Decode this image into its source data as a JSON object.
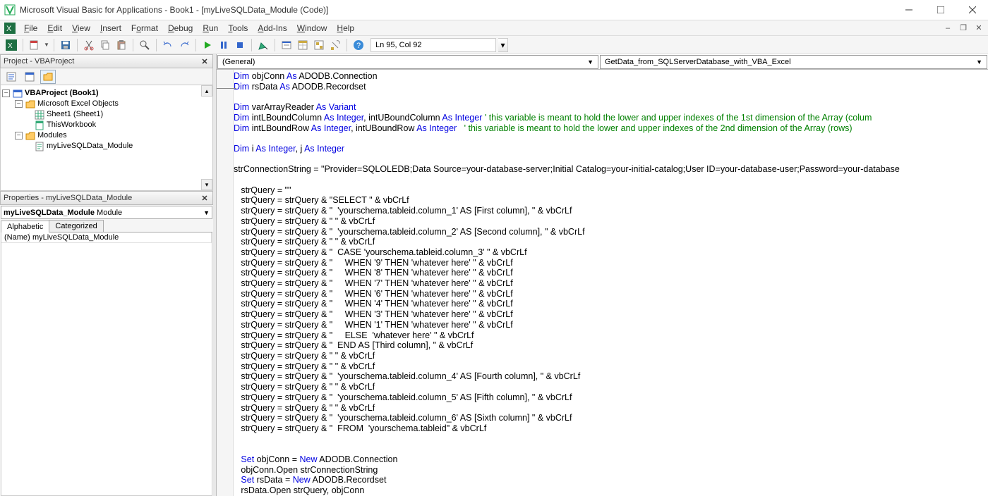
{
  "window": {
    "title": "Microsoft Visual Basic for Applications - Book1 - [myLiveSQLData_Module (Code)]"
  },
  "menus": {
    "file": "File",
    "edit": "Edit",
    "view": "View",
    "insert": "Insert",
    "format": "Format",
    "debug": "Debug",
    "run": "Run",
    "tools": "Tools",
    "addins": "Add-Ins",
    "window": "Window",
    "help": "Help"
  },
  "toolbar_status": "Ln 95, Col 92",
  "project_pane": {
    "title": "Project - VBAProject",
    "tree": {
      "root": "VBAProject (Book1)",
      "excel_objects": "Microsoft Excel Objects",
      "sheet1": "Sheet1 (Sheet1)",
      "thisworkbook": "ThisWorkbook",
      "modules": "Modules",
      "module1": "myLiveSQLData_Module"
    }
  },
  "properties_pane": {
    "title": "Properties - myLiveSQLData_Module",
    "combo_name": "myLiveSQLData_Module",
    "combo_type": "Module",
    "tab_alpha": "Alphabetic",
    "tab_cat": "Categorized",
    "row_name_key": "(Name)",
    "row_name_val": "myLiveSQLData_Module"
  },
  "code_combos": {
    "object": "(General)",
    "procedure": "GetData_from_SQLServerDatabase_with_VBA_Excel"
  },
  "code": {
    "tokens": [
      [
        [
          "kw",
          "Dim"
        ],
        [
          "",
          " objConn "
        ],
        [
          "kw",
          "As"
        ],
        [
          "",
          " ADODB.Connection"
        ]
      ],
      [
        [
          "kw",
          "Dim"
        ],
        [
          "",
          " rsData "
        ],
        [
          "kw",
          "As"
        ],
        [
          "",
          " ADODB.Recordset"
        ]
      ],
      [],
      [
        [
          "kw",
          "Dim"
        ],
        [
          "",
          " varArrayReader "
        ],
        [
          "kw",
          "As"
        ],
        [
          "",
          " "
        ],
        [
          "kw",
          "Variant"
        ]
      ],
      [
        [
          "kw",
          "Dim"
        ],
        [
          "",
          " intLBoundColumn "
        ],
        [
          "kw",
          "As"
        ],
        [
          "",
          " "
        ],
        [
          "kw",
          "Integer"
        ],
        [
          "",
          ", intUBoundColumn "
        ],
        [
          "kw",
          "As"
        ],
        [
          "",
          " "
        ],
        [
          "kw",
          "Integer"
        ],
        [
          "",
          " "
        ],
        [
          "cm",
          "' this variable is meant to hold the lower and upper indexes of the 1st dimension of the Array (colum"
        ]
      ],
      [
        [
          "kw",
          "Dim"
        ],
        [
          "",
          " intLBoundRow "
        ],
        [
          "kw",
          "As"
        ],
        [
          "",
          " "
        ],
        [
          "kw",
          "Integer"
        ],
        [
          "",
          ", intUBoundRow "
        ],
        [
          "kw",
          "As"
        ],
        [
          "",
          " "
        ],
        [
          "kw",
          "Integer"
        ],
        [
          "",
          "   "
        ],
        [
          "cm",
          "' this variable is meant to hold the lower and upper indexes of the 2nd dimension of the Array (rows)"
        ]
      ],
      [],
      [
        [
          "kw",
          "Dim"
        ],
        [
          "",
          " i "
        ],
        [
          "kw",
          "As"
        ],
        [
          "",
          " "
        ],
        [
          "kw",
          "Integer"
        ],
        [
          "",
          ", j "
        ],
        [
          "kw",
          "As"
        ],
        [
          "",
          " "
        ],
        [
          "kw",
          "Integer"
        ]
      ],
      [],
      [
        [
          "",
          "strConnectionString = \"Provider=SQLOLEDB;Data Source=your-database-server;Initial Catalog=your-initial-catalog;User ID=your-database-user;Password=your-database"
        ]
      ],
      [],
      [
        [
          "",
          "   strQuery = \"\""
        ]
      ],
      [
        [
          "",
          "   strQuery = strQuery & \"SELECT \" & vbCrLf"
        ]
      ],
      [
        [
          "",
          "   strQuery = strQuery & \"  'yourschema.tableid.column_1' AS [First column], \" & vbCrLf"
        ]
      ],
      [
        [
          "",
          "   strQuery = strQuery & \" \" & vbCrLf"
        ]
      ],
      [
        [
          "",
          "   strQuery = strQuery & \"  'yourschema.tableid.column_2' AS [Second column], \" & vbCrLf"
        ]
      ],
      [
        [
          "",
          "   strQuery = strQuery & \" \" & vbCrLf"
        ]
      ],
      [
        [
          "",
          "   strQuery = strQuery & \"  CASE 'yourschema.tableid.column_3' \" & vbCrLf"
        ]
      ],
      [
        [
          "",
          "   strQuery = strQuery & \"     WHEN '9' THEN 'whatever here' \" & vbCrLf"
        ]
      ],
      [
        [
          "",
          "   strQuery = strQuery & \"     WHEN '8' THEN 'whatever here' \" & vbCrLf"
        ]
      ],
      [
        [
          "",
          "   strQuery = strQuery & \"     WHEN '7' THEN 'whatever here' \" & vbCrLf"
        ]
      ],
      [
        [
          "",
          "   strQuery = strQuery & \"     WHEN '6' THEN 'whatever here' \" & vbCrLf"
        ]
      ],
      [
        [
          "",
          "   strQuery = strQuery & \"     WHEN '4' THEN 'whatever here' \" & vbCrLf"
        ]
      ],
      [
        [
          "",
          "   strQuery = strQuery & \"     WHEN '3' THEN 'whatever here' \" & vbCrLf"
        ]
      ],
      [
        [
          "",
          "   strQuery = strQuery & \"     WHEN '1' THEN 'whatever here' \" & vbCrLf"
        ]
      ],
      [
        [
          "",
          "   strQuery = strQuery & \"     ELSE  'whatever here' \" & vbCrLf"
        ]
      ],
      [
        [
          "",
          "   strQuery = strQuery & \"  END AS [Third column], \" & vbCrLf"
        ]
      ],
      [
        [
          "",
          "   strQuery = strQuery & \" \" & vbCrLf"
        ]
      ],
      [
        [
          "",
          "   strQuery = strQuery & \" \" & vbCrLf"
        ]
      ],
      [
        [
          "",
          "   strQuery = strQuery & \"  'yourschema.tableid.column_4' AS [Fourth column], \" & vbCrLf"
        ]
      ],
      [
        [
          "",
          "   strQuery = strQuery & \" \" & vbCrLf"
        ]
      ],
      [
        [
          "",
          "   strQuery = strQuery & \"  'yourschema.tableid.column_5' AS [Fifth column], \" & vbCrLf"
        ]
      ],
      [
        [
          "",
          "   strQuery = strQuery & \" \" & vbCrLf"
        ]
      ],
      [
        [
          "",
          "   strQuery = strQuery & \"  'yourschema.tableid.column_6' AS [Sixth column] \" & vbCrLf"
        ]
      ],
      [
        [
          "",
          "   strQuery = strQuery & \"  FROM  'yourschema.tableid\" & vbCrLf"
        ]
      ],
      [],
      [],
      [
        [
          "",
          "   "
        ],
        [
          "kw",
          "Set"
        ],
        [
          "",
          " objConn = "
        ],
        [
          "kw",
          "New"
        ],
        [
          "",
          " ADODB.Connection"
        ]
      ],
      [
        [
          "",
          "   objConn.Open strConnectionString"
        ]
      ],
      [
        [
          "",
          "   "
        ],
        [
          "kw",
          "Set"
        ],
        [
          "",
          " rsData = "
        ],
        [
          "kw",
          "New"
        ],
        [
          "",
          " ADODB.Recordset"
        ]
      ],
      [
        [
          "",
          "   rsData.Open strQuery, objConn"
        ]
      ]
    ]
  }
}
